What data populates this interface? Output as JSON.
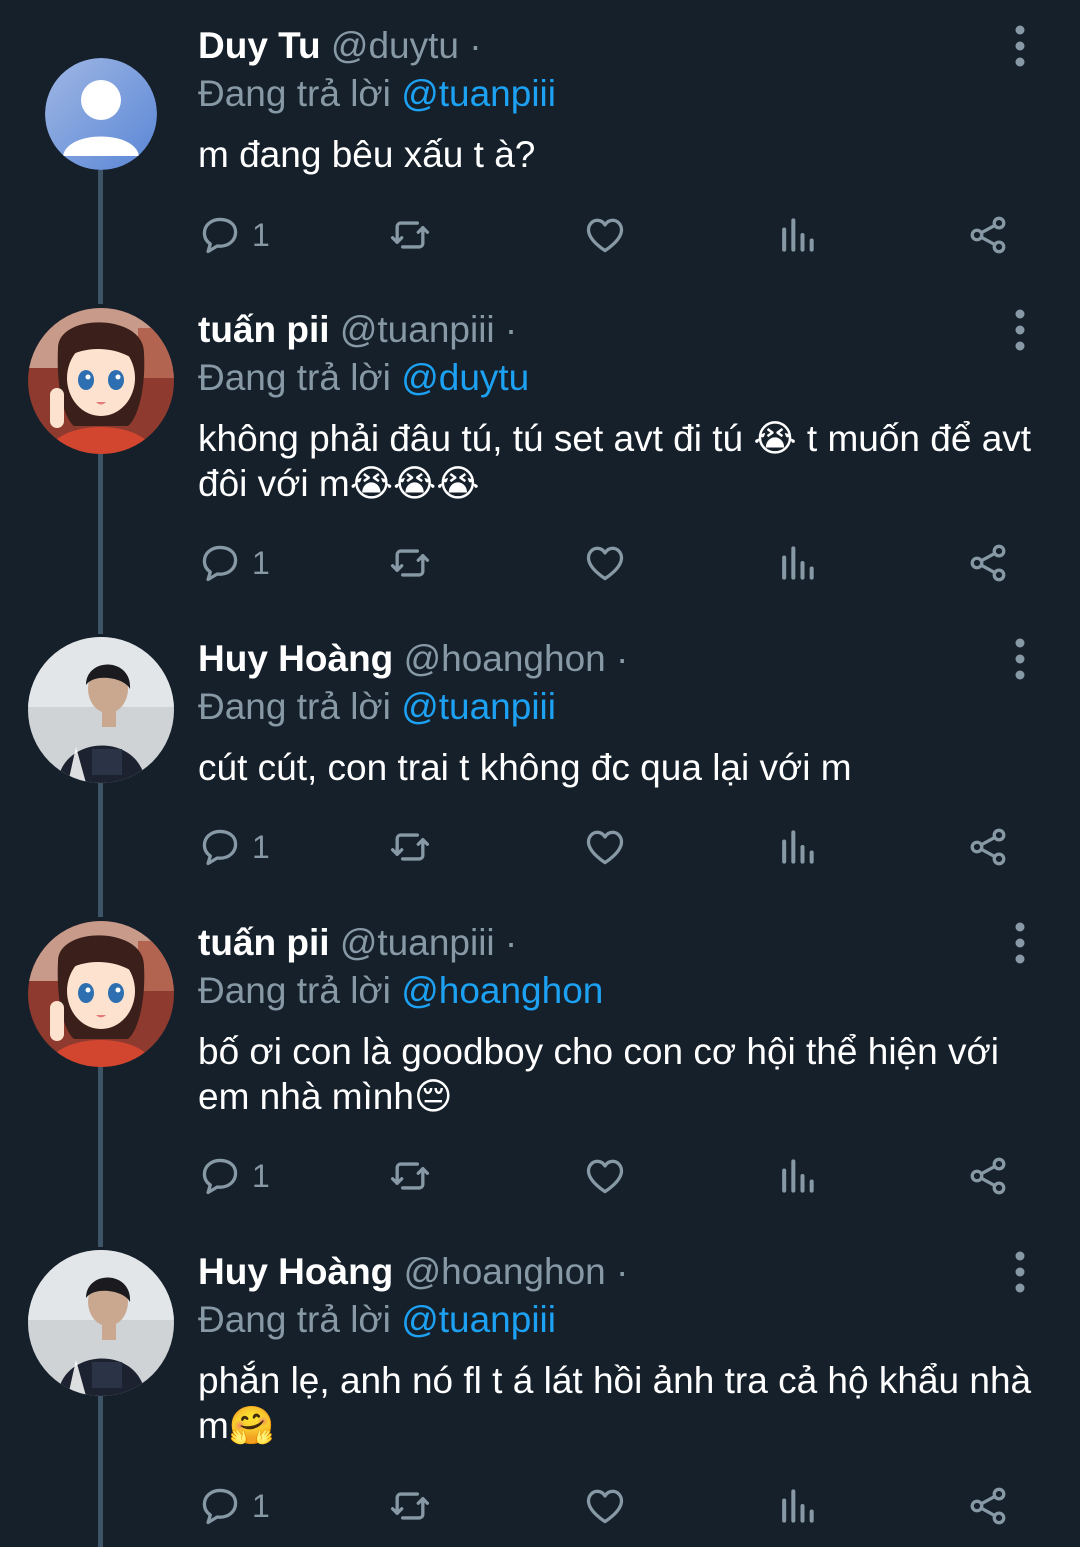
{
  "colors": {
    "background": "#15202b",
    "accent": "#1da1f2",
    "muted": "#8899a6",
    "thread_line": "#3d5466"
  },
  "tweets": [
    {
      "display_name": "Duy Tu",
      "handle": "@duytu",
      "separator": "·",
      "replying_prefix": "Đang trả lời",
      "replying_to": "@tuanpiii",
      "text": "m đang bêu xấu t à?",
      "reply_count": "1",
      "avatar": "default-avatar"
    },
    {
      "display_name": "tuấn pii",
      "handle": "@tuanpiii",
      "separator": "·",
      "replying_prefix": "Đang trả lời",
      "replying_to": "@duytu",
      "text": "không phải đâu tú, tú set avt đi tú 😭 t muốn để avt đôi với m😭😭😭",
      "reply_count": "1",
      "avatar": "anime-girl-avatar"
    },
    {
      "display_name": "Huy Hoàng",
      "handle": "@hoanghon",
      "separator": "·",
      "replying_prefix": "Đang trả lời",
      "replying_to": "@tuanpiii",
      "text": "cút cút, con trai t không đc qua lại với m",
      "reply_count": "1",
      "avatar": "photo-avatar"
    },
    {
      "display_name": "tuấn pii",
      "handle": "@tuanpiii",
      "separator": "·",
      "replying_prefix": "Đang trả lời",
      "replying_to": "@hoanghon",
      "text": "bố ơi con là goodboy cho con cơ hội thể hiện với em nhà mình😔",
      "reply_count": "1",
      "avatar": "anime-girl-avatar"
    },
    {
      "display_name": "Huy Hoàng",
      "handle": "@hoanghon",
      "separator": "·",
      "replying_prefix": "Đang trả lời",
      "replying_to": "@tuanpiii",
      "text": "phắn lẹ, anh nó fl t á lát hồi ảnh tra cả hộ khẩu nhà m🤗",
      "reply_count": "1",
      "avatar": "photo-avatar"
    }
  ],
  "icons": {
    "reply": "reply-icon",
    "retweet": "retweet-icon",
    "like": "heart-icon",
    "stats": "stats-icon",
    "share": "share-icon",
    "more": "more-vertical-icon"
  }
}
